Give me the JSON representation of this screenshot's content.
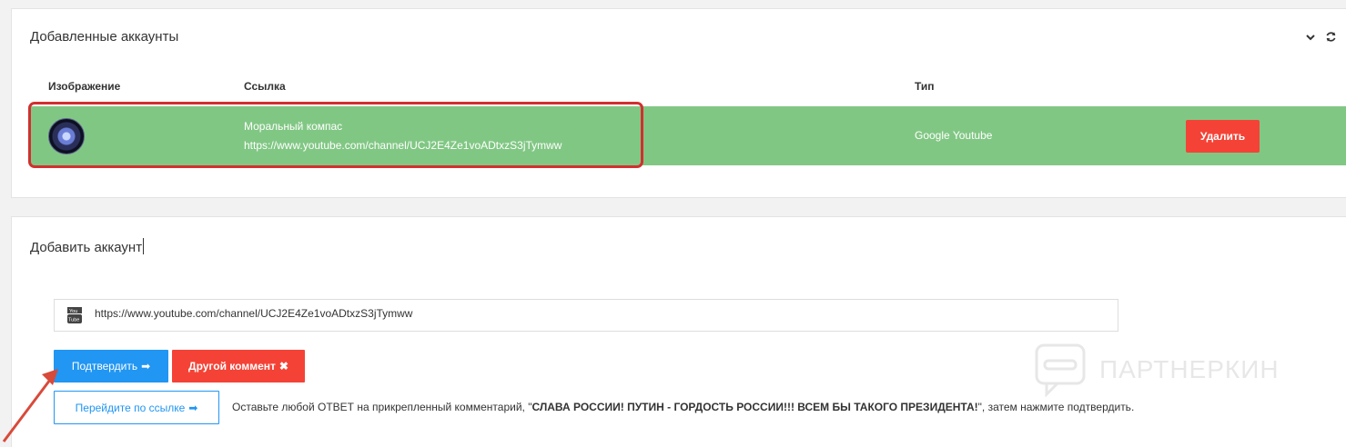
{
  "accounts_panel": {
    "title": "Добавленные аккаунты",
    "columns": {
      "image": "Изображение",
      "link": "Ссылка",
      "type": "Тип"
    },
    "row": {
      "name": "Моральный компас",
      "url": "https://www.youtube.com/channel/UCJ2E4Ze1voADtxzS3jTymww",
      "type": "Google Youtube",
      "delete_label": "Удалить"
    },
    "icons": [
      "chevron-down-icon",
      "refresh-icon"
    ]
  },
  "add_panel": {
    "title": "Добавить аккаунт",
    "url_value": "https://www.youtube.com/channel/UCJ2E4Ze1voADtxzS3jTymww",
    "confirm_label": "Подтвердить",
    "other_label": "Другой коммент",
    "follow_label": "Перейдите по ссылке",
    "instruction_prefix": "Оставьте любой ОТВЕТ на прикрепленный комментарий, \"",
    "instruction_bold": "СЛАВА РОССИИ! ПУТИН - ГОРДОСТЬ РОССИИ!!! ВСЕМ БЫ ТАКОГО ПРЕЗИДЕНТА!",
    "instruction_suffix": "\", затем нажмите подтвердить."
  },
  "watermark": {
    "text": "ПАРТНЕРКИН"
  },
  "colors": {
    "row_bg": "#81c784",
    "primary": "#2196f3",
    "danger": "#f44336",
    "highlight": "#d32f2f"
  }
}
